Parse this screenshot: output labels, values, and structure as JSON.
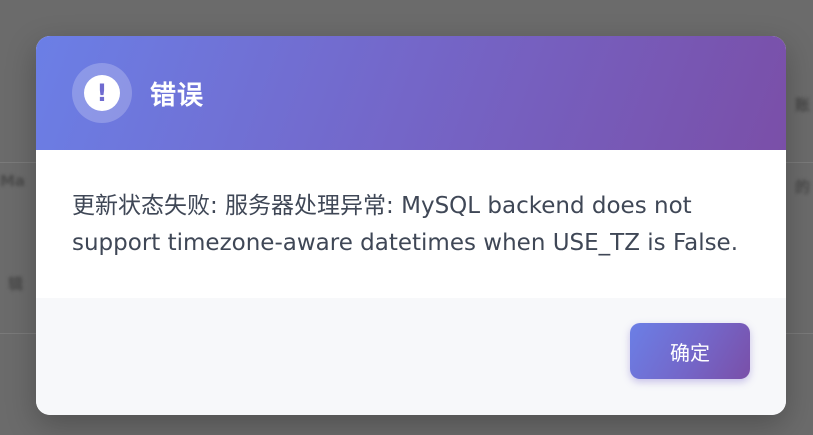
{
  "background": {
    "fragments": [
      "账",
      "Ma",
      "的",
      "辑"
    ]
  },
  "dialog": {
    "title": "错误",
    "icon": "exclamation-icon",
    "icon_glyph": "!",
    "message": "更新状态失败: 服务器处理异常: MySQL backend does not support timezone-aware datetimes when USE_TZ is False.",
    "confirm_label": "确定",
    "colors": {
      "gradient_start": "#6b7fe6",
      "gradient_end": "#7a4fa8",
      "body_text": "#3f4756",
      "footer_bg": "#f7f8fa"
    }
  }
}
